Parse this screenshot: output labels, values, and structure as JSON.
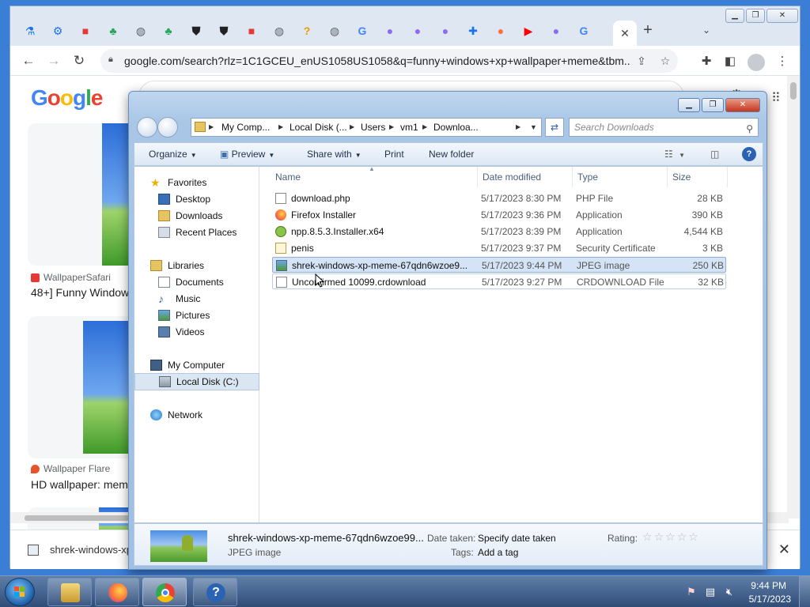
{
  "chrome": {
    "url": "google.com/search?rlz=1C1GCEU_enUS1058US1058&q=funny+windows+xp+wallpaper+meme&tbm...",
    "logo": "Google",
    "results": [
      {
        "source": "WallpaperSafari",
        "title": "48+] Funny Window"
      },
      {
        "source": "Wallpaper Flare",
        "title": "HD wallpaper: mem"
      }
    ],
    "download_bar": {
      "item": "shrek-windows-xp"
    },
    "tabs": [
      {
        "icon": "flask-icon",
        "color": "#1a73e8"
      },
      {
        "icon": "gear-icon",
        "color": "#1a73e8"
      },
      {
        "icon": "roblox-icon",
        "color": "#e53935"
      },
      {
        "icon": "green-leaf-icon",
        "color": "#26a65b"
      },
      {
        "icon": "globe-icon",
        "color": "#5f6368"
      },
      {
        "icon": "green-leaf-icon",
        "color": "#26a65b"
      },
      {
        "icon": "shield-icon",
        "color": "#202124"
      },
      {
        "icon": "shield-icon",
        "color": "#202124"
      },
      {
        "icon": "roblox-icon",
        "color": "#e53935"
      },
      {
        "icon": "globe-icon",
        "color": "#5f6368"
      },
      {
        "icon": "question-icon",
        "color": "#f29900"
      },
      {
        "icon": "globe-icon",
        "color": "#5f6368"
      },
      {
        "icon": "google-icon",
        "color": "#4285f4"
      },
      {
        "icon": "orb-icon",
        "color": "#8e6cf0"
      },
      {
        "icon": "orb-icon",
        "color": "#8e6cf0"
      },
      {
        "icon": "orb-icon",
        "color": "#8e6cf0"
      },
      {
        "icon": "puzzle-icon",
        "color": "#1a73e8"
      },
      {
        "icon": "firefox-icon",
        "color": "#ff7139"
      },
      {
        "icon": "youtube-icon",
        "color": "#ff0000"
      },
      {
        "icon": "orb-icon",
        "color": "#8e6cf0"
      },
      {
        "icon": "google-icon",
        "color": "#4285f4"
      }
    ]
  },
  "explorer": {
    "breadcrumb": [
      "My Comp...",
      "Local Disk (...",
      "Users",
      "vm1",
      "Downloa..."
    ],
    "search_placeholder": "Search Downloads",
    "commands": {
      "organize": "Organize",
      "preview": "Preview",
      "share": "Share with",
      "print": "Print",
      "new_folder": "New folder"
    },
    "nav": {
      "favorites": "Favorites",
      "desktop": "Desktop",
      "downloads": "Downloads",
      "recent": "Recent Places",
      "libraries": "Libraries",
      "documents": "Documents",
      "music": "Music",
      "pictures": "Pictures",
      "videos": "Videos",
      "computer": "My Computer",
      "local_disk": "Local Disk (C:)",
      "network": "Network"
    },
    "columns": {
      "name": "Name",
      "date": "Date modified",
      "type": "Type",
      "size": "Size"
    },
    "files": [
      {
        "name": "download.php",
        "date": "5/17/2023 8:30 PM",
        "type": "PHP File",
        "size": "28 KB",
        "icon": "php-file-icon"
      },
      {
        "name": "Firefox Installer",
        "date": "5/17/2023 9:36 PM",
        "type": "Application",
        "size": "390 KB",
        "icon": "firefox-installer-icon"
      },
      {
        "name": "npp.8.5.3.Installer.x64",
        "date": "5/17/2023 8:39 PM",
        "type": "Application",
        "size": "4,544 KB",
        "icon": "notepadpp-icon"
      },
      {
        "name": "penis",
        "date": "5/17/2023 9:37 PM",
        "type": "Security Certificate",
        "size": "3 KB",
        "icon": "certificate-icon"
      },
      {
        "name": "shrek-windows-xp-meme-67qdn6wzoe9...",
        "date": "5/17/2023 9:44 PM",
        "type": "JPEG image",
        "size": "250 KB",
        "icon": "jpeg-image-icon"
      },
      {
        "name": "Unconfirmed 10099.crdownload",
        "date": "5/17/2023 9:27 PM",
        "type": "CRDOWNLOAD File",
        "size": "32 KB",
        "icon": "blank-file-icon"
      }
    ],
    "details": {
      "filename": "shrek-windows-xp-meme-67qdn6wzoe99...",
      "filetype": "JPEG image",
      "date_taken_label": "Date taken:",
      "date_taken_value": "Specify date taken",
      "tags_label": "Tags:",
      "tags_value": "Add a tag",
      "rating_label": "Rating:"
    }
  },
  "taskbar": {
    "time": "9:44 PM",
    "date": "5/17/2023"
  }
}
